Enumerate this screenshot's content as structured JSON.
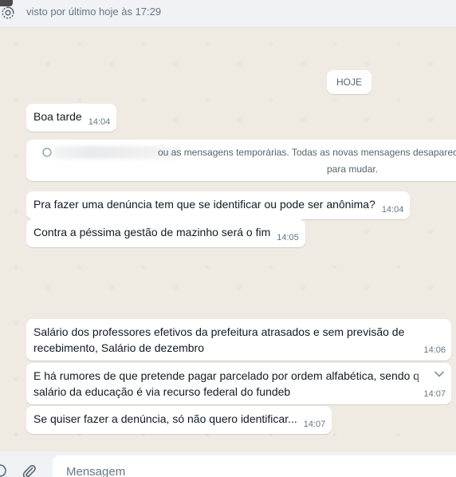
{
  "header": {
    "status": "visto por último hoje às 17:29",
    "status_icon": "timer-icon"
  },
  "chat": {
    "date_chip": "HOJE",
    "messages": [
      {
        "text": "Boa tarde",
        "time": "14:04"
      },
      {
        "text": "Pra fazer uma denúncia tem que se identificar ou pode ser anônima?",
        "time": "14:04"
      },
      {
        "text": "Contra a péssima gestão de mazinho será o fim",
        "time": "14:05"
      },
      {
        "text": "Salário dos professores efetivos da prefeitura atrasados e sem previsão de recebimento, Salário de dezembro",
        "time": "14:06"
      },
      {
        "text_line1": "E há rumores de que pretende pagar parcelado por ordem alfabética, sendo q",
        "text_line2": "salário da educação é  via recurso federal do fundeb",
        "time": "14:07",
        "menu_icon": "chevron-down-icon"
      },
      {
        "text": "Se quiser fazer a denúncia, só não quero identificar...",
        "time": "14:07"
      }
    ],
    "system_notice": {
      "line1": "ou as mensagens temporárias. Todas as novas mensagens desaparec",
      "line2": "para mudar."
    }
  },
  "footer": {
    "input_placeholder": "Mensagem",
    "emoji_icon": "emoji-icon",
    "attach_icon": "paperclip-icon"
  }
}
